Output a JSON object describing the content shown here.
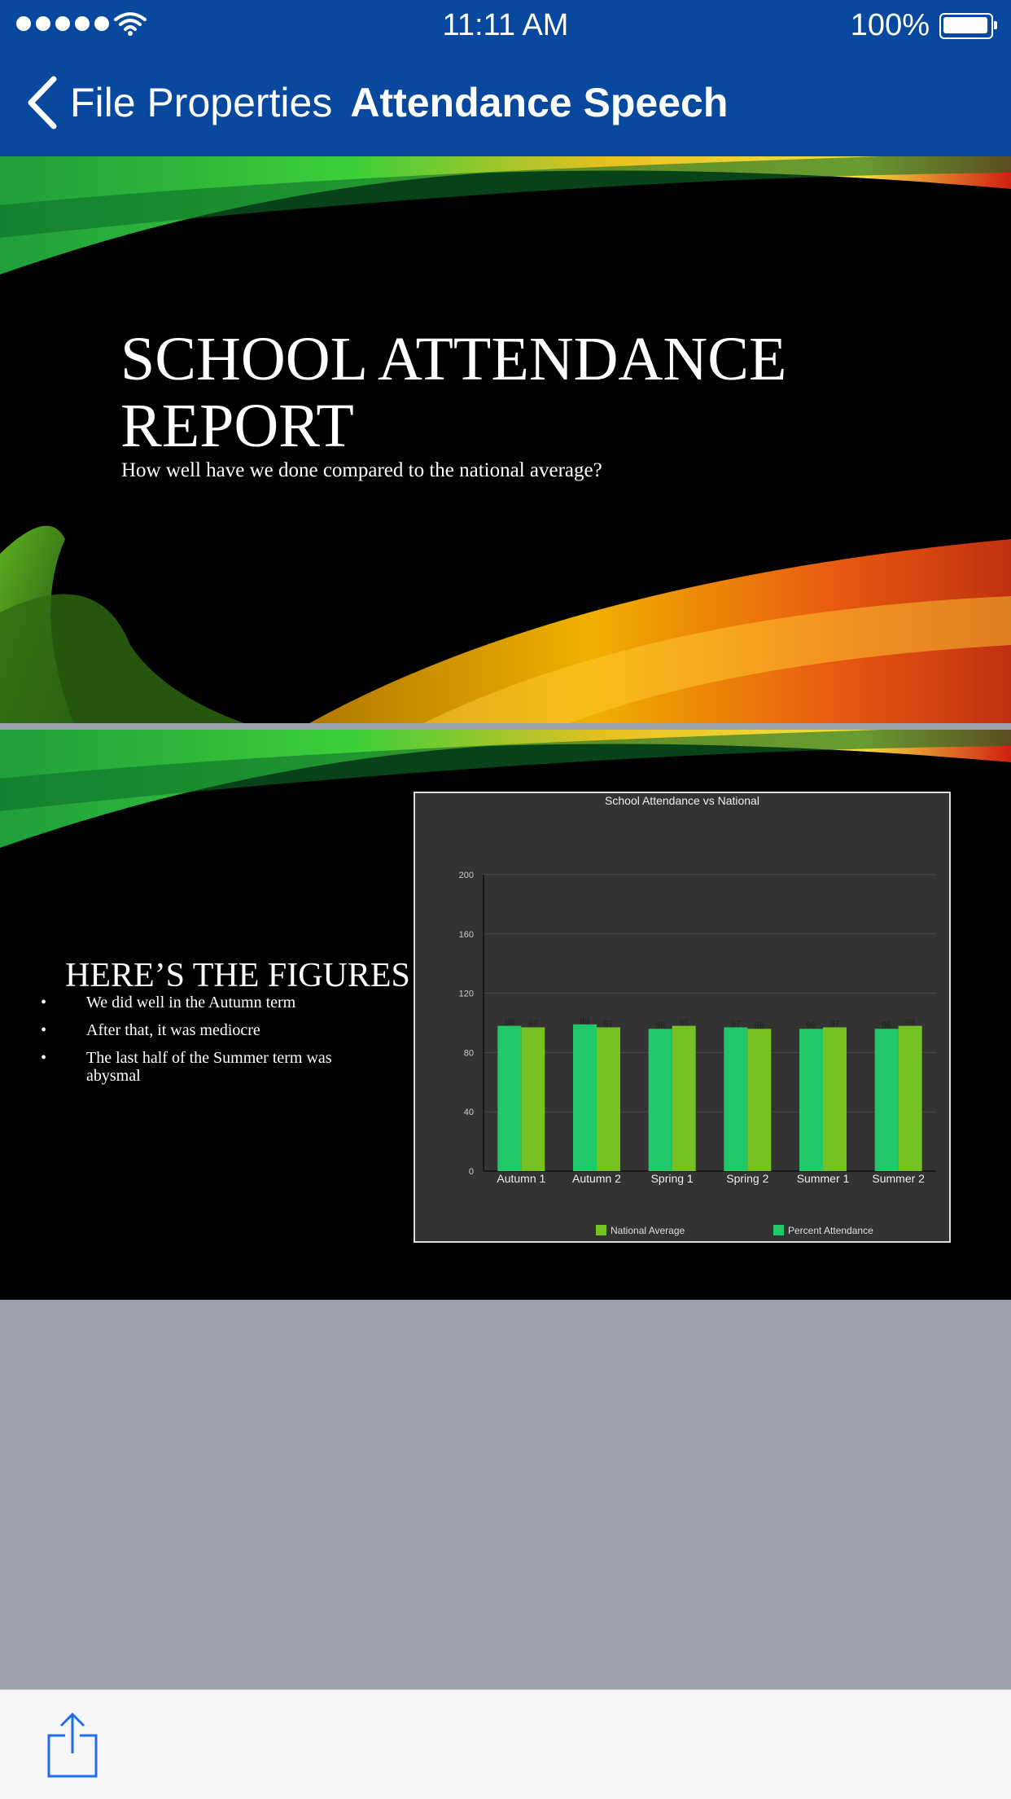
{
  "status_bar": {
    "time": "11:11 AM",
    "battery": "100%",
    "signal_icon": "signal-dots-icon",
    "wifi_icon": "wifi-icon",
    "battery_icon": "battery-icon"
  },
  "nav": {
    "back_label": "File Properties",
    "title": "Attendance Speech",
    "back_icon": "chevron-left-icon"
  },
  "slide1": {
    "title_line1": "SCHOOL ATTENDANCE",
    "title_line2": "REPORT",
    "subtitle": "How well have we done compared to the national average?"
  },
  "slide2": {
    "heading": "HERE’S THE FIGURES",
    "bullets": [
      "We did well in the Autumn term",
      "After that, it was mediocre",
      "The last half of the Summer term was abysmal"
    ]
  },
  "chart_data": {
    "type": "bar",
    "title": "School Attendance vs National",
    "categories": [
      "Autumn 1",
      "Autumn 2",
      "Spring 1",
      "Spring 2",
      "Summer 1",
      "Summer 2"
    ],
    "series": [
      {
        "name": "Percent Attendance",
        "color": "#20c86a",
        "values": [
          98,
          99,
          96,
          97,
          96,
          96
        ]
      },
      {
        "name": "National Average",
        "color": "#76c223",
        "values": [
          97,
          97,
          98,
          96,
          97,
          98
        ]
      }
    ],
    "yticks": [
      0,
      40,
      80,
      120,
      160,
      200
    ],
    "ylim": [
      0,
      200
    ],
    "grid": true,
    "legend": "bottom",
    "legend_order": [
      "National Average",
      "Percent Attendance"
    ]
  },
  "toolbar": {
    "share_icon": "share-icon"
  },
  "colors": {
    "header": "#08489e",
    "background": "#9ca2ad",
    "toolbar": "#f7f7f9",
    "share_blue": "#1d6ee8"
  }
}
